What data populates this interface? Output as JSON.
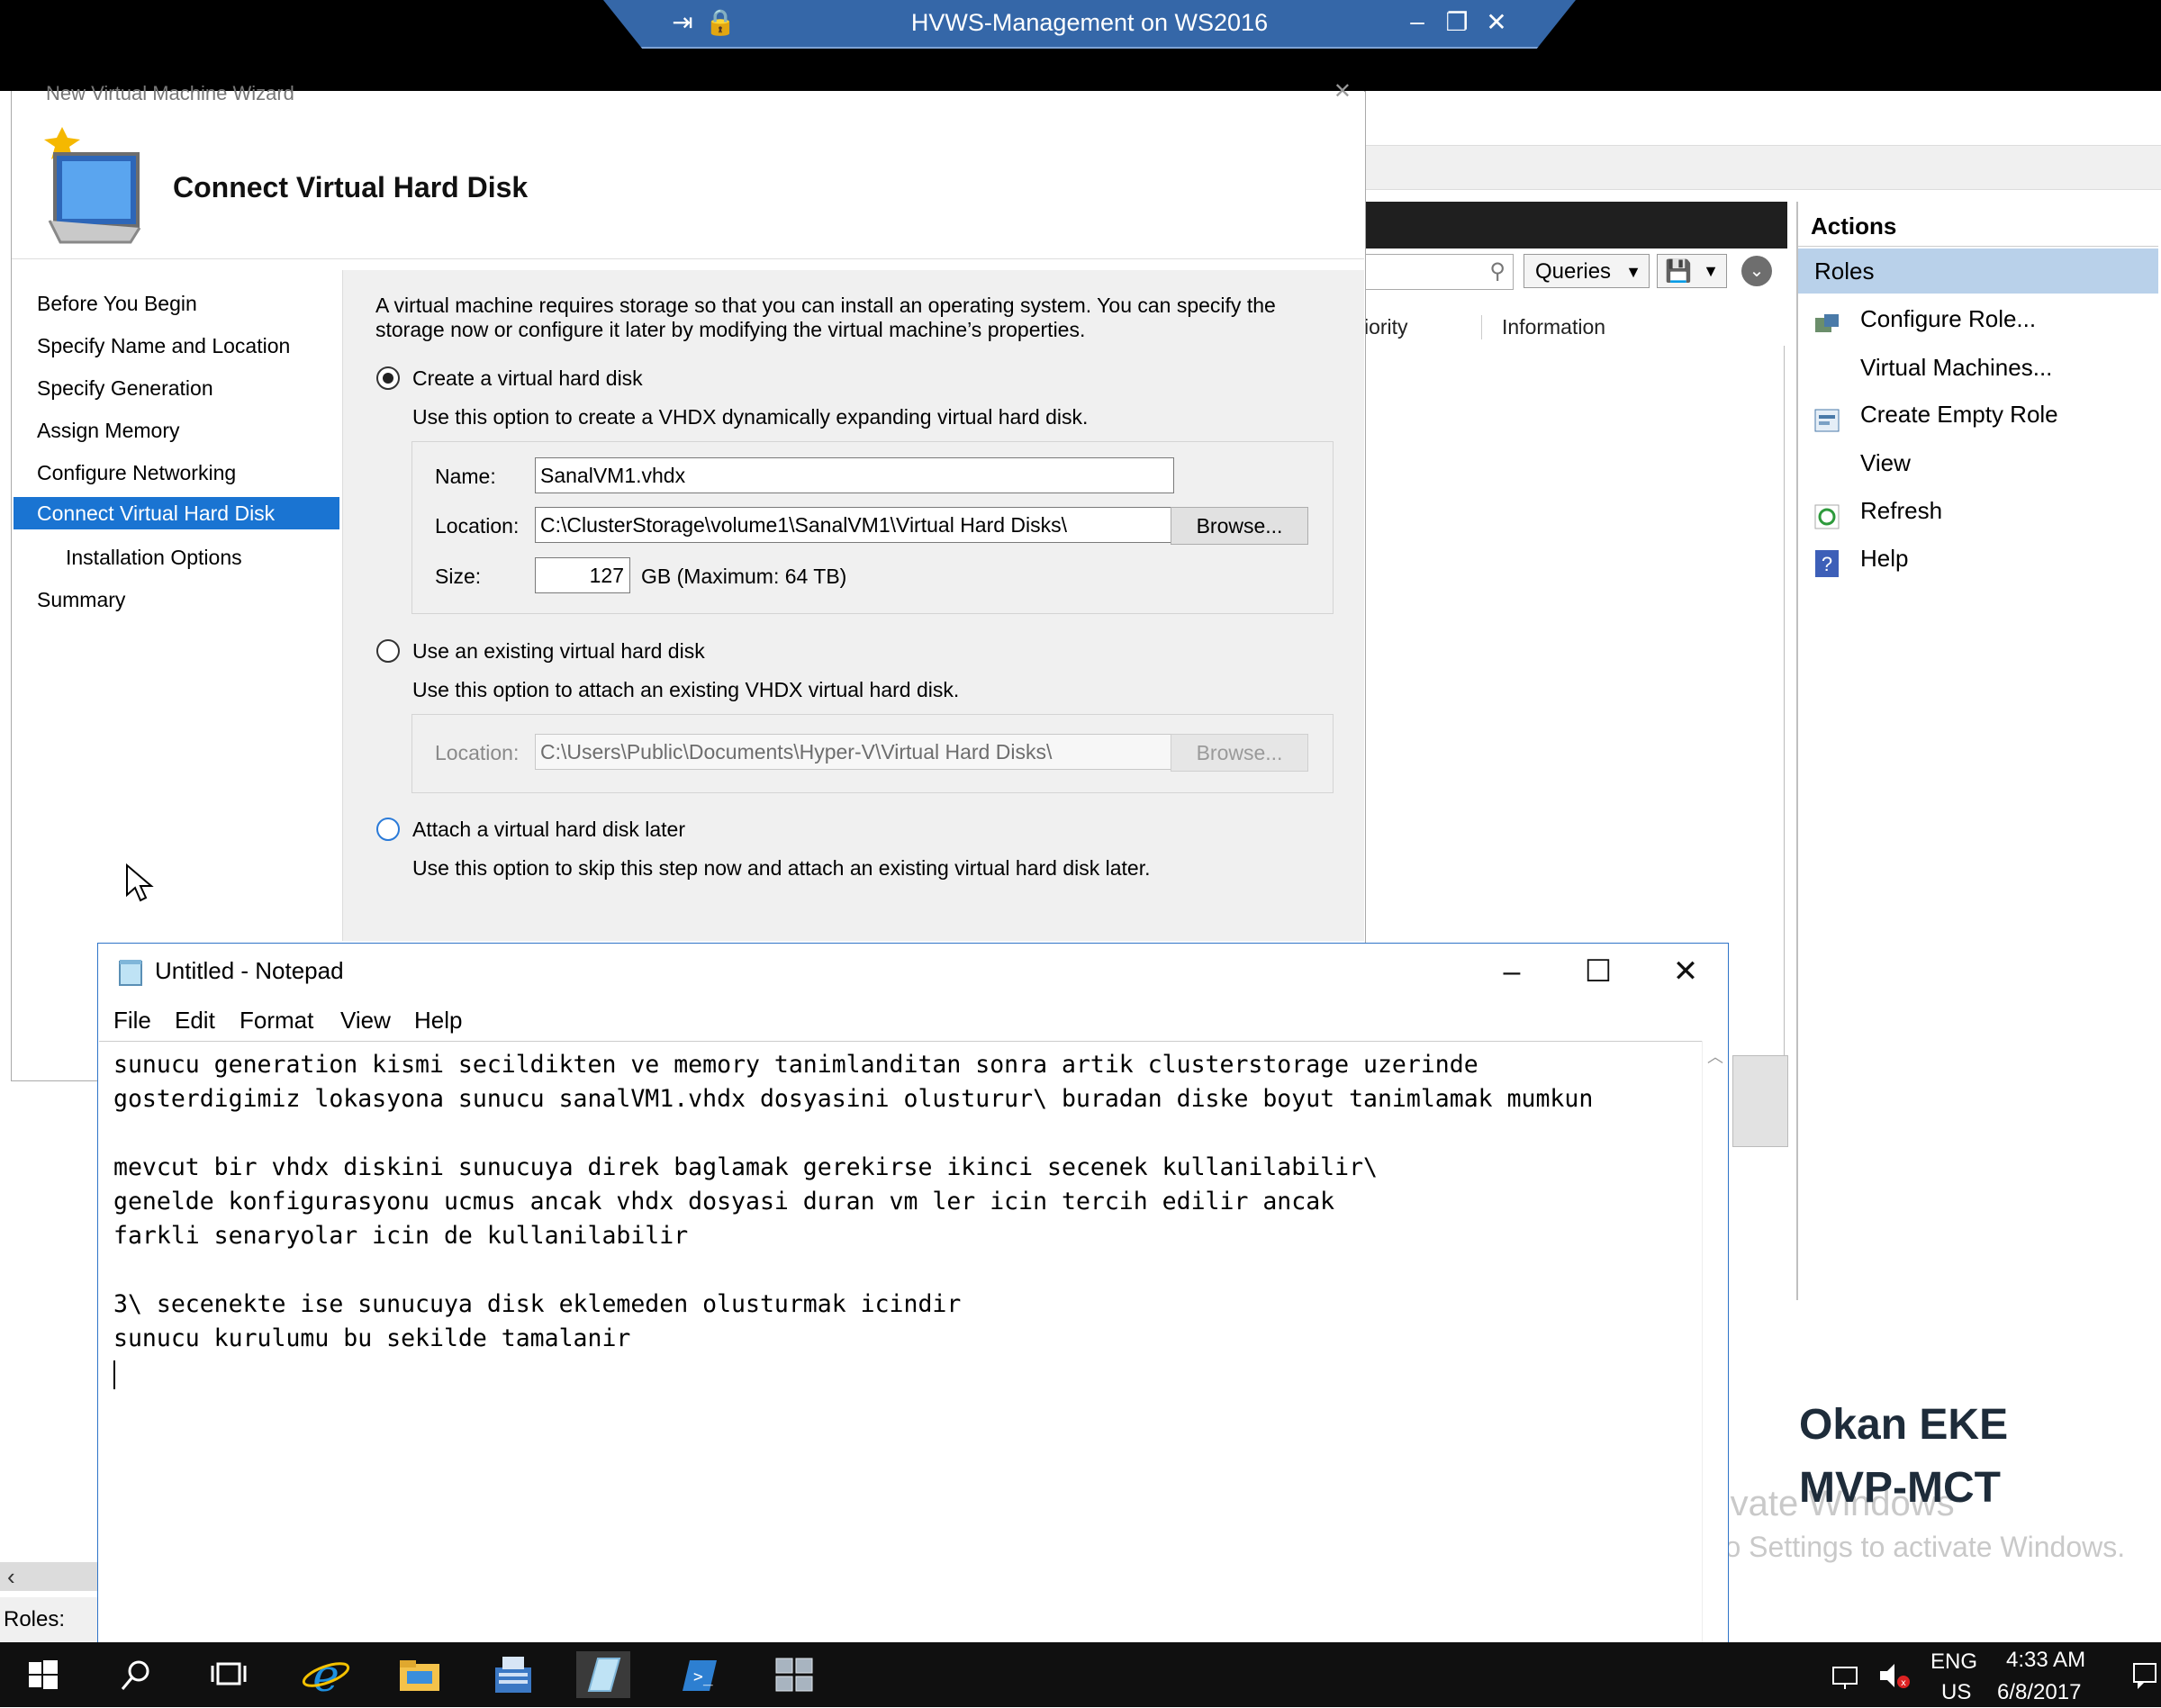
{
  "remote_bar": {
    "title": "HVWS-Management on WS2016"
  },
  "cluster_manager": {
    "search": {
      "queries_label": "Queries"
    },
    "columns": [
      "iority",
      "Information"
    ],
    "actions": {
      "title": "Actions",
      "selected": "Roles",
      "items": [
        {
          "label": "Configure Role...",
          "icon": "configure-role-icon"
        },
        {
          "label": "Virtual Machines...",
          "icon": ""
        },
        {
          "label": "Create Empty Role",
          "icon": "create-empty-role-icon"
        },
        {
          "label": "View",
          "icon": ""
        },
        {
          "label": "Refresh",
          "icon": "refresh-icon"
        },
        {
          "label": "Help",
          "icon": "help-icon"
        }
      ]
    },
    "status_label": "Roles:",
    "overlay_name": "Okan EKE",
    "overlay_title": "MVP-MCT",
    "activation_line1": "Activate Windows",
    "activation_line2": "Go to Settings to activate Windows."
  },
  "wizard": {
    "window_title": "New Virtual Machine Wizard",
    "page_title": "Connect Virtual Hard Disk",
    "nav": [
      "Before You Begin",
      "Specify Name and Location",
      "Specify Generation",
      "Assign Memory",
      "Configure Networking",
      "Connect Virtual Hard Disk",
      "Installation Options",
      "Summary"
    ],
    "selected_nav_index": 5,
    "intro": [
      "A virtual machine requires storage so that you can install an operating system. You can specify the",
      "storage now or configure it later by modifying the virtual machine’s properties."
    ],
    "option_create": {
      "label": "Create a virtual hard disk",
      "description": "Use this option to create a VHDX dynamically expanding virtual hard disk.",
      "name_label": "Name:",
      "name_value": "SanalVM1.vhdx",
      "location_label": "Location:",
      "location_value": "C:\\ClusterStorage\\volume1\\SanalVM1\\Virtual Hard Disks\\",
      "browse_label": "Browse...",
      "size_label": "Size:",
      "size_value": "127",
      "size_unit": "GB (Maximum: 64 TB)",
      "selected": true
    },
    "option_existing": {
      "label": "Use an existing virtual hard disk",
      "description": "Use this option to attach an existing VHDX virtual hard disk.",
      "location_label": "Location:",
      "location_value": "C:\\Users\\Public\\Documents\\Hyper-V\\Virtual Hard Disks\\",
      "browse_label": "Browse..."
    },
    "option_later": {
      "label": "Attach a virtual hard disk later",
      "description": "Use this option to skip this step now and attach an existing virtual hard disk later."
    }
  },
  "notepad": {
    "title": "Untitled - Notepad",
    "menu": [
      "File",
      "Edit",
      "Format",
      "View",
      "Help"
    ],
    "lines": [
      "sunucu generation kismi secildikten ve memory tanimlanditan sonra artik clusterstorage uzerinde",
      "gosterdigimiz lokasyona sunucu sanalVM1.vhdx dosyasini olusturur\\ buradan diske boyut tanimlamak mumkun",
      "",
      "mevcut bir vhdx diskini sunucuya direk baglamak gerekirse ikinci secenek kullanilabilir\\",
      "genelde konfigurasyonu ucmus ancak vhdx dosyasi duran vm ler icin tercih edilir ancak",
      "farkli senaryolar icin de kullanilabilir",
      "",
      "3\\ secenekte ise sunucuya disk eklemeden olusturmak icindir",
      "sunucu kurulumu bu sekilde tamalanir"
    ]
  },
  "taskbar": {
    "lang1": "ENG",
    "lang2": "US",
    "time": "4:33 AM",
    "date": "6/8/2017"
  }
}
